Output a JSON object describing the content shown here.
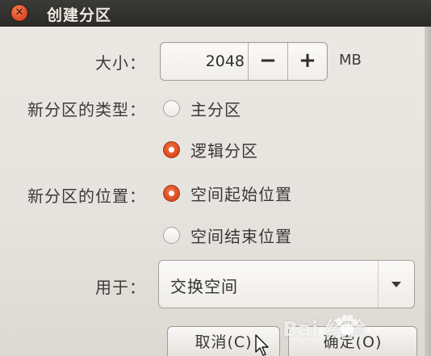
{
  "window": {
    "title": "创建分区",
    "close_icon": "close-icon"
  },
  "form": {
    "size_label": "大小：",
    "size_value": "2048",
    "size_minus": "−",
    "size_plus": "+",
    "size_unit": "MB",
    "type_label": "新分区的类型：",
    "type_options": [
      {
        "label": "主分区",
        "selected": false
      },
      {
        "label": "逻辑分区",
        "selected": true
      }
    ],
    "position_label": "新分区的位置：",
    "position_options": [
      {
        "label": "空间起始位置",
        "selected": true
      },
      {
        "label": "空间结束位置",
        "selected": false
      }
    ],
    "use_label": "用于：",
    "use_value": "交换空间"
  },
  "buttons": {
    "cancel": "取消(C)",
    "ok": "确定(O)"
  },
  "watermark": {
    "text": "Bai  经验"
  },
  "colors": {
    "titlebar": "#2b2a27",
    "accent": "#de4d20",
    "background": "#e6e3de"
  }
}
